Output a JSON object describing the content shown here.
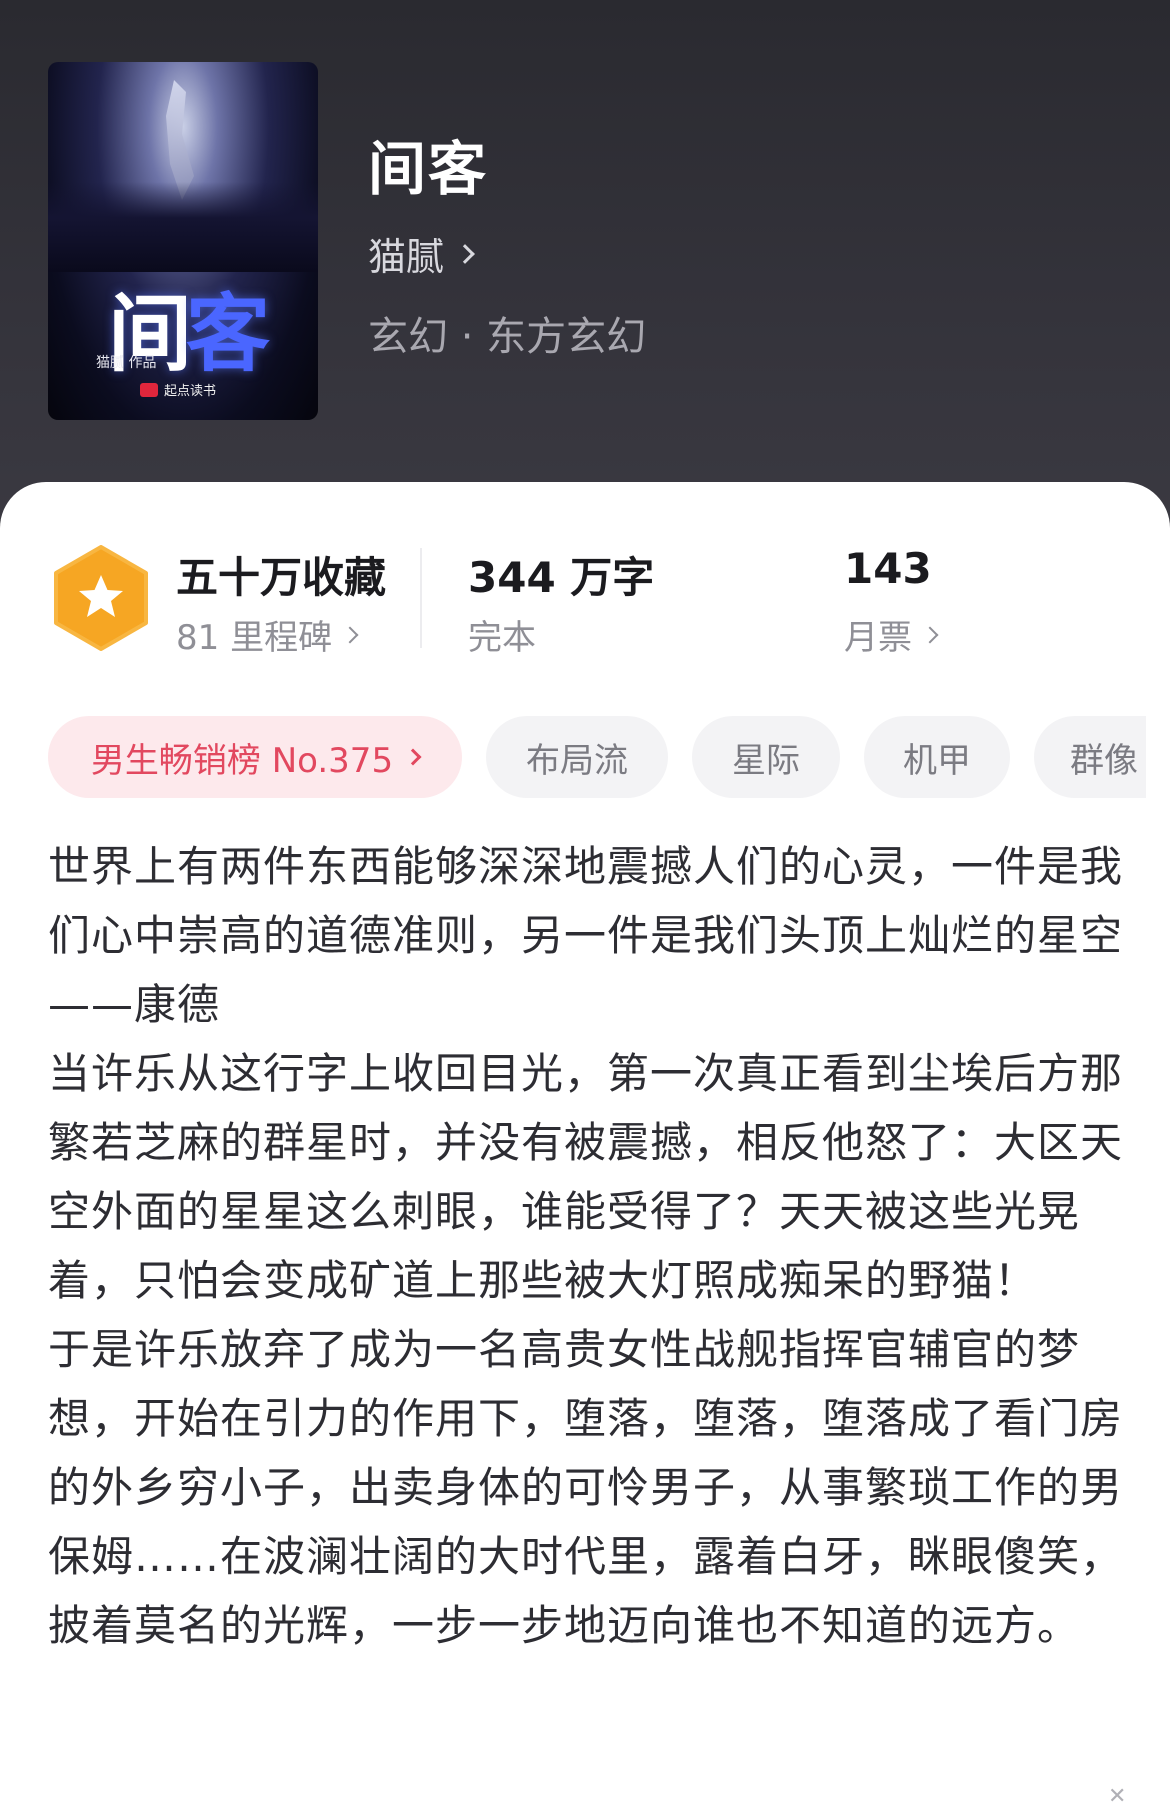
{
  "book": {
    "title": "间客",
    "author": "猫腻",
    "genre": "玄幻 · 东方玄幻"
  },
  "cover": {
    "title_part1": "间",
    "title_part2": "客",
    "author_line": "猫腻 作品",
    "publisher": "起点读书"
  },
  "stats": {
    "collect_title": "五十万收藏",
    "collect_sub": "81 里程碑",
    "words_title": "344 万字",
    "words_sub": "完本",
    "tickets_title": "143",
    "tickets_sub": "月票"
  },
  "tags": {
    "rank": "男生畅销榜 No.375",
    "t1": "布局流",
    "t2": "星际",
    "t3": "机甲",
    "t4": "群像"
  },
  "description": {
    "p1": "世界上有两件东西能够深深地震撼人们的心灵，一件是我们心中崇高的道德准则，另一件是我们头顶上灿烂的星空——康德",
    "p2": "当许乐从这行字上收回目光，第一次真正看到尘埃后方那繁若芝麻的群星时，并没有被震撼，相反他怒了：大区天空外面的星星这么刺眼，谁能受得了？天天被这些光晃着，只怕会变成矿道上那些被大灯照成痴呆的野猫！",
    "p3": "于是许乐放弃了成为一名高贵女性战舰指挥官辅官的梦想，开始在引力的作用下，堕落，堕落，堕落成了看门房的外乡穷小子，出卖身体的可怜男子，从事繁琐工作的男保姆……在波澜壮阔的大时代里，露着白牙，眯眼傻笑，披着莫名的光辉，一步一步地迈向谁也不知道的远方。"
  },
  "colors": {
    "header_bg": "#2a2a30",
    "badge_orange": "#f6a623",
    "rank_text": "#e2485f",
    "rank_bg": "#fde9ec"
  },
  "icons": [
    "star-badge-icon",
    "chevron-right-icon",
    "close-icon"
  ]
}
